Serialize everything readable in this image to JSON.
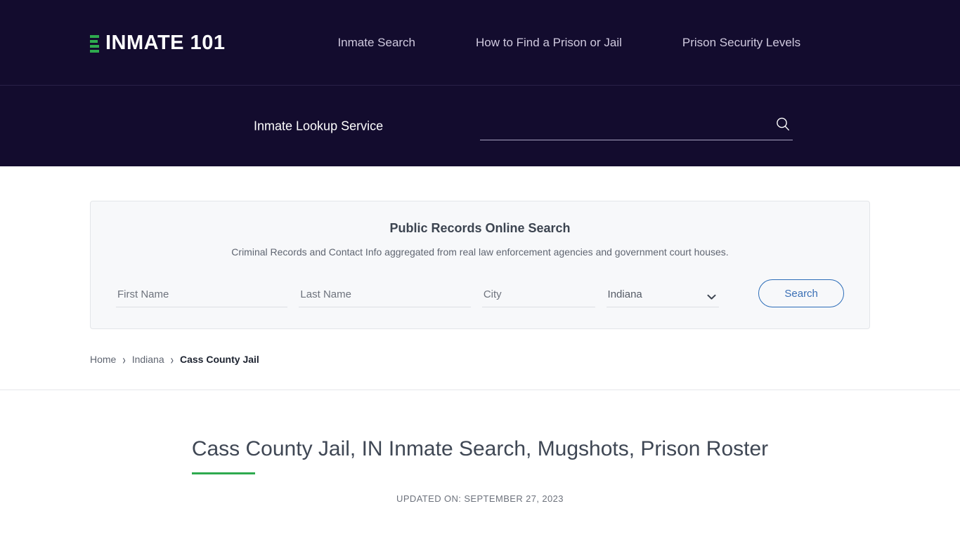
{
  "header": {
    "logo_text": "INMATE 101",
    "nav": [
      {
        "label": "Inmate Search"
      },
      {
        "label": "How to Find a Prison or Jail"
      },
      {
        "label": "Prison Security Levels"
      }
    ]
  },
  "lookup": {
    "label": "Inmate Lookup Service",
    "input_value": "",
    "input_placeholder": ""
  },
  "records_card": {
    "title": "Public Records Online Search",
    "subtitle": "Criminal Records and Contact Info aggregated from real law enforcement agencies and government court houses.",
    "first_name_placeholder": "First Name",
    "first_name_value": "",
    "last_name_placeholder": "Last Name",
    "last_name_value": "",
    "city_placeholder": "City",
    "city_value": "",
    "state_selected": "Indiana",
    "state_options": [
      "Indiana"
    ],
    "search_label": "Search"
  },
  "breadcrumb": {
    "home": "Home",
    "state": "Indiana",
    "current": "Cass County Jail",
    "separator": "›"
  },
  "page": {
    "title": "Cass County Jail, IN Inmate Search, Mugshots, Prison Roster",
    "updated": "UPDATED ON: SEPTEMBER 27, 2023"
  },
  "colors": {
    "header_bg": "#130c2e",
    "accent_green": "#2eaa4e",
    "button_blue": "#3a6fb5",
    "card_bg": "#f7f8fa"
  }
}
